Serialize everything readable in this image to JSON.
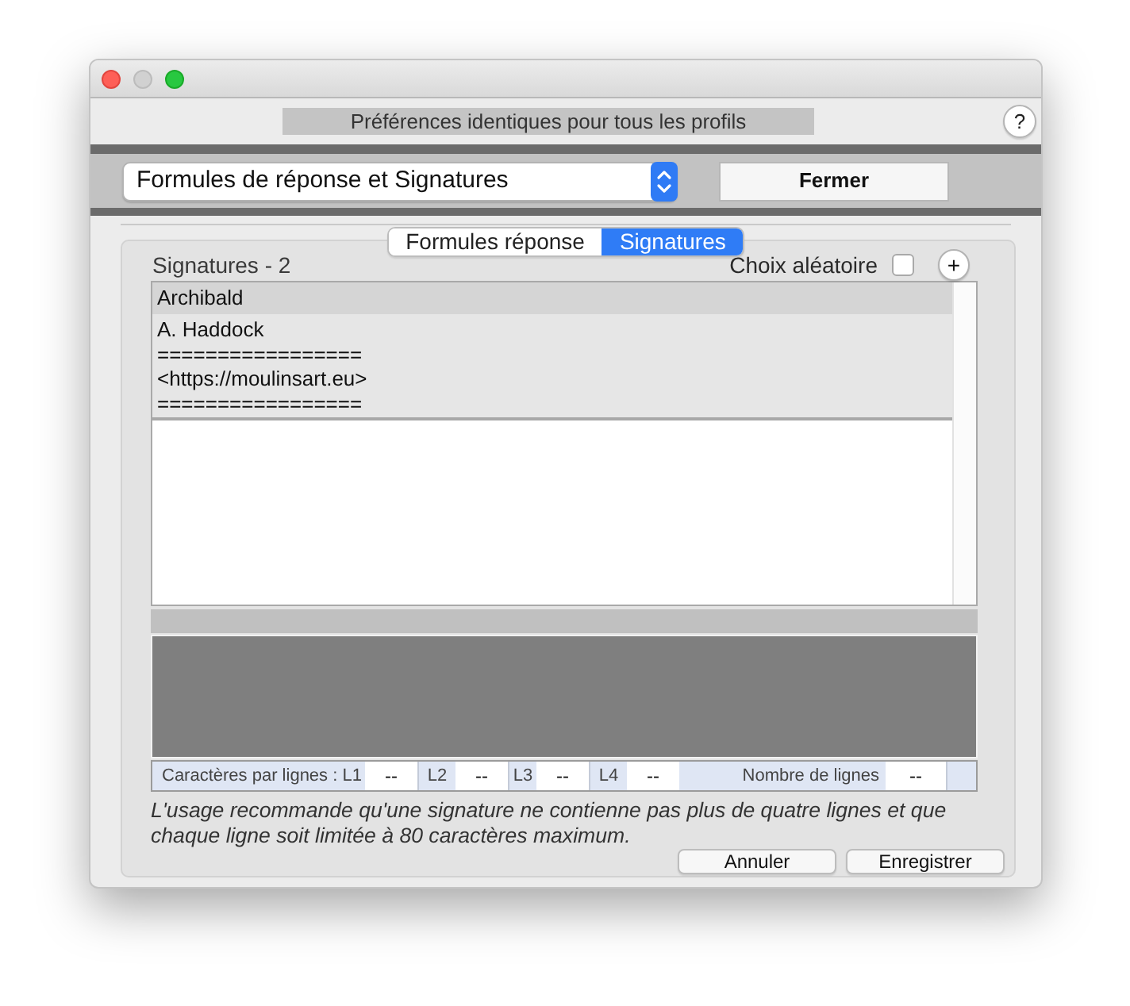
{
  "window_controls": [
    {
      "kind": "close",
      "disabled": false
    },
    {
      "kind": "minimize",
      "disabled": true
    },
    {
      "kind": "zoom",
      "disabled": false
    }
  ],
  "header": {
    "label": "Préférences identiques pour tous les profils",
    "help_button": "?"
  },
  "toolbar": {
    "section_select": {
      "value": "Formules de réponse et Signatures"
    },
    "close_button": "Fermer"
  },
  "tabs": [
    {
      "label": "Formules réponse",
      "selected": false
    },
    {
      "label": "Signatures",
      "selected": true
    }
  ],
  "signatures_panel": {
    "title": "Signatures - 2",
    "random_choice": {
      "label": "Choix aléatoire",
      "checked": false
    },
    "add_button": "+",
    "signatures": [
      {
        "name": "Archibald",
        "lines": [
          "A. Haddock",
          "=================",
          "<https://moulinsart.eu>",
          "================="
        ]
      }
    ],
    "stats_bar": {
      "label": "Caractères par lignes :",
      "line_fields": [
        {
          "label": "L1",
          "value": "--"
        },
        {
          "label": "L2",
          "value": "--"
        },
        {
          "label": "L3",
          "value": "--"
        },
        {
          "label": "L4",
          "value": "--"
        }
      ],
      "line_count": {
        "label": "Nombre de lignes",
        "value": "--"
      }
    },
    "note": "L'usage recommande qu'une signature ne contienne pas plus de quatre lignes et que chaque ligne soit limitée à 80 caractères maximum.",
    "buttons": [
      "Annuler",
      "Enregistrer"
    ]
  }
}
